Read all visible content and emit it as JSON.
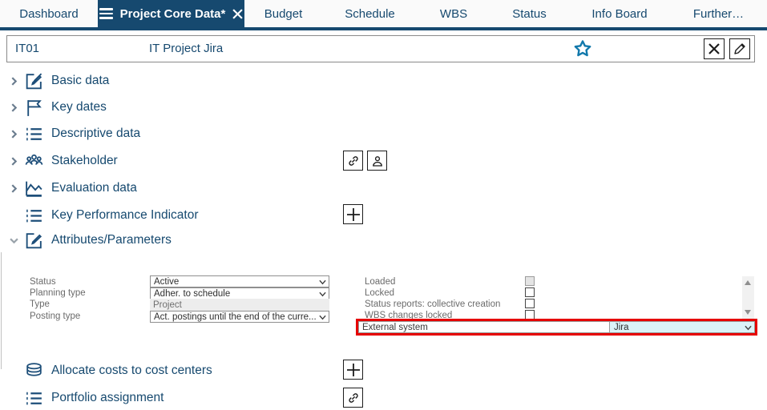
{
  "colors": {
    "navy": "#16496f",
    "star_blue": "#1178ab",
    "highlight_red": "#e60000",
    "selection_cyan": "#dbf3f8"
  },
  "tabs": {
    "items": [
      {
        "label": "Dashboard",
        "active": false
      },
      {
        "label": "Project Core Data*",
        "active": true
      },
      {
        "label": "Budget",
        "active": false
      },
      {
        "label": "Schedule",
        "active": false
      },
      {
        "label": "WBS",
        "active": false
      },
      {
        "label": "Status",
        "active": false
      },
      {
        "label": "Info Board",
        "active": false
      },
      {
        "label": "Further…",
        "active": false
      }
    ]
  },
  "header": {
    "project_id": "IT01",
    "project_title": "IT Project Jira"
  },
  "sections": {
    "items": [
      {
        "label": "Basic data",
        "icon": "edit-icon",
        "state": "collapsed"
      },
      {
        "label": "Key dates",
        "icon": "flag-icon",
        "state": "collapsed"
      },
      {
        "label": "Descriptive data",
        "icon": "list-icon",
        "state": "collapsed"
      },
      {
        "label": "Stakeholder",
        "icon": "people-icon",
        "state": "collapsed"
      },
      {
        "label": "Evaluation data",
        "icon": "chart-icon",
        "state": "collapsed"
      },
      {
        "label": "Key Performance Indicator",
        "icon": "list-icon",
        "state": "none"
      },
      {
        "label": "Attributes/Parameters",
        "icon": "edit-icon",
        "state": "expanded"
      },
      {
        "label": "Allocate costs to cost centers",
        "icon": "coins-icon",
        "state": "none"
      },
      {
        "label": "Portfolio assignment",
        "icon": "list-icon",
        "state": "none"
      }
    ]
  },
  "form": {
    "left": [
      {
        "label": "Status",
        "value": "Active",
        "control": "select"
      },
      {
        "label": "Planning type",
        "value": "Adher. to schedule",
        "control": "select"
      },
      {
        "label": "Type",
        "value": "Project",
        "control": "readonly"
      },
      {
        "label": "Posting type",
        "value": "Act. postings until the end of the curre...",
        "control": "select"
      }
    ],
    "checkboxes": [
      {
        "label": "Loaded",
        "checked": false,
        "disabled": true
      },
      {
        "label": "Locked",
        "checked": false,
        "disabled": false
      },
      {
        "label": "Status reports: collective creation",
        "checked": false,
        "disabled": false
      },
      {
        "label": "WBS changes locked",
        "checked": false,
        "disabled": false
      }
    ],
    "external_system": {
      "label": "External system",
      "value": "Jira"
    }
  }
}
